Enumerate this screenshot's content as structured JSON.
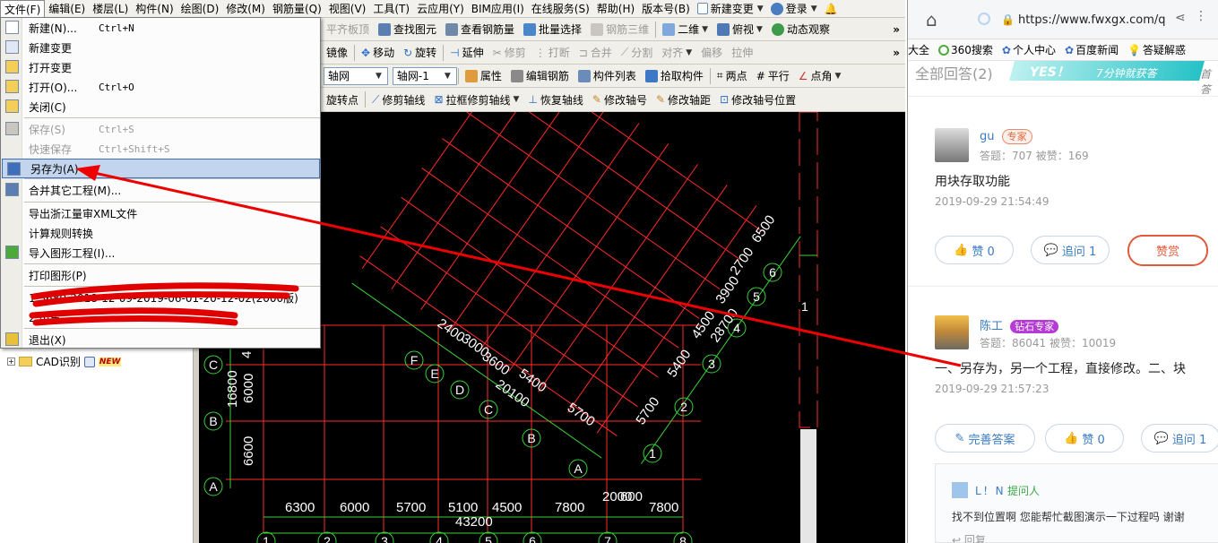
{
  "menubar": {
    "items": [
      "文件(F)",
      "编辑(E)",
      "楼层(L)",
      "构件(N)",
      "绘图(D)",
      "修改(M)",
      "钢筋量(Q)",
      "视图(V)",
      "工具(T)",
      "云应用(Y)",
      "BIM应用(I)",
      "在线服务(S)",
      "帮助(H)",
      "版本号(B)"
    ],
    "new_change": "新建变更",
    "login": "登录"
  },
  "toolbar1": {
    "items": [
      "平齐板顶",
      "查找图元",
      "查看钢筋量",
      "批量选择",
      "钢筋三维",
      "二维",
      "俯视",
      "动态观察"
    ]
  },
  "toolbar2": {
    "items": [
      "镜像",
      "移动",
      "旋转",
      "延伸",
      "修剪",
      "打断",
      "合并",
      "分割",
      "对齐",
      "偏移",
      "拉伸"
    ]
  },
  "toolbar3": {
    "axis_type": "轴网",
    "axis_name": "轴网-1",
    "items": [
      "属性",
      "编辑钢筋",
      "构件列表",
      "拾取构件",
      "两点",
      "平行",
      "点角"
    ]
  },
  "toolbar4": {
    "items": [
      "旋转点",
      "修剪轴线",
      "拉框修剪轴线",
      "恢复轴线",
      "修改轴号",
      "修改轴距",
      "修改轴号位置"
    ]
  },
  "file_menu": {
    "items": [
      {
        "label": "新建(N)...",
        "shortcut": "Ctrl+N",
        "icon": "new-file-icon",
        "enabled": true
      },
      {
        "label": "新建变更",
        "shortcut": "",
        "icon": "new-change-icon",
        "enabled": true
      },
      {
        "label": "打开变更",
        "shortcut": "",
        "icon": "open-change-icon",
        "enabled": true
      },
      {
        "label": "打开(O)...",
        "shortcut": "Ctrl+O",
        "icon": "open-folder-icon",
        "enabled": true
      },
      {
        "label": "关闭(C)",
        "shortcut": "",
        "icon": "close-folder-icon",
        "enabled": true
      },
      {
        "label": "保存(S)",
        "shortcut": "Ctrl+S",
        "icon": "save-icon",
        "enabled": false
      },
      {
        "label": "快速保存",
        "shortcut": "Ctrl+Shift+S",
        "icon": "",
        "enabled": false
      },
      {
        "label": "另存为(A)",
        "shortcut": "",
        "icon": "save-as-icon",
        "enabled": true,
        "highlighted": true
      },
      {
        "label": "合并其它工程(M)...",
        "shortcut": "",
        "icon": "merge-icon",
        "enabled": true
      },
      {
        "label": "导出浙江量审XML文件",
        "shortcut": "",
        "icon": "",
        "enabled": true
      },
      {
        "label": "计算规则转换",
        "shortcut": "",
        "icon": "",
        "enabled": true
      },
      {
        "label": "导入图形工程(I)...",
        "shortcut": "",
        "icon": "import-icon",
        "enabled": true
      },
      {
        "label": "打印图形(P)",
        "shortcut": "",
        "icon": "",
        "enabled": true
      },
      {
        "label": "1 3680-2018-12-09-2019-06-01-20-12-02(2000版)",
        "shortcut": "",
        "icon": "",
        "enabled": true
      },
      {
        "label": "2 山东…",
        "shortcut": "",
        "icon": "",
        "enabled": true
      },
      {
        "label": "退出(X)",
        "shortcut": "",
        "icon": "exit-icon",
        "enabled": true
      }
    ]
  },
  "tree": {
    "items": [
      {
        "label": "CAD识别",
        "badge": "NEW"
      }
    ]
  },
  "cad": {
    "left_axes": [
      "C",
      "B",
      "A"
    ],
    "left_dims": [
      "16800",
      "6000",
      "6600",
      "4"
    ],
    "bottom_dims": [
      "6300",
      "6000",
      "5700",
      "5100",
      "4500",
      "7800",
      "2000",
      "7800"
    ],
    "bottom_total": "43200",
    "bottom_dims_extra": "600",
    "bottom_axes": [
      "1",
      "2",
      "3",
      "4",
      "5",
      "6",
      "7",
      "8"
    ],
    "rot_letters": [
      "F",
      "E",
      "D",
      "C",
      "B",
      "A"
    ],
    "rot_numbers": [
      "6",
      "5",
      "4",
      "3",
      "2",
      "1"
    ],
    "rot_dims_left": [
      "2400",
      "3000",
      "3600",
      "5400",
      "5700"
    ],
    "rot_total_left": "20100",
    "rot_dims_right": [
      "6500",
      "2700",
      "3900",
      "4500",
      "5400",
      "5700"
    ],
    "rot_total_right": "28700",
    "right_edge_label": "1"
  },
  "browser": {
    "url": "https://www.fwxgx.com/q",
    "bookmarks": [
      "大全",
      "360搜索",
      "个人中心",
      "百度新闻",
      "答疑解惑"
    ],
    "answers_count": "全部回答(2)",
    "banner_yes": "YES！",
    "banner_text": "7分钟就获答",
    "banner_side": "首答",
    "answers": [
      {
        "name": "gu",
        "badge": "专家",
        "stats": "答题：707    被赞：169",
        "text": "用块存取功能",
        "time": "2019-09-29 21:54:49",
        "like": "赞 0",
        "ask": "追问  1",
        "reward": "赞赏"
      },
      {
        "name": "陈工",
        "badge": "钻石专家",
        "stats": "答题：86041    被赞：10019",
        "text": "一、另存为，另一个工程，直接修改。二、块",
        "time": "2019-09-29 21:57:23",
        "improve": "完善答案",
        "like": "赞 0",
        "ask": "追问  1"
      }
    ],
    "comment": {
      "name": "L！N",
      "role": "提问人",
      "text": "找不到位置啊 您能帮忙截图演示一下过程吗 谢谢",
      "reply": "回复"
    }
  },
  "colors": {
    "menu_highlight": "#c2d4ee",
    "cad_bg": "#000000",
    "cad_red": "#ff2a2a",
    "cad_green": "#39d239",
    "cad_white": "#ffffff",
    "link_blue": "#3a7cc4",
    "annotation_red": "#ff0000"
  }
}
